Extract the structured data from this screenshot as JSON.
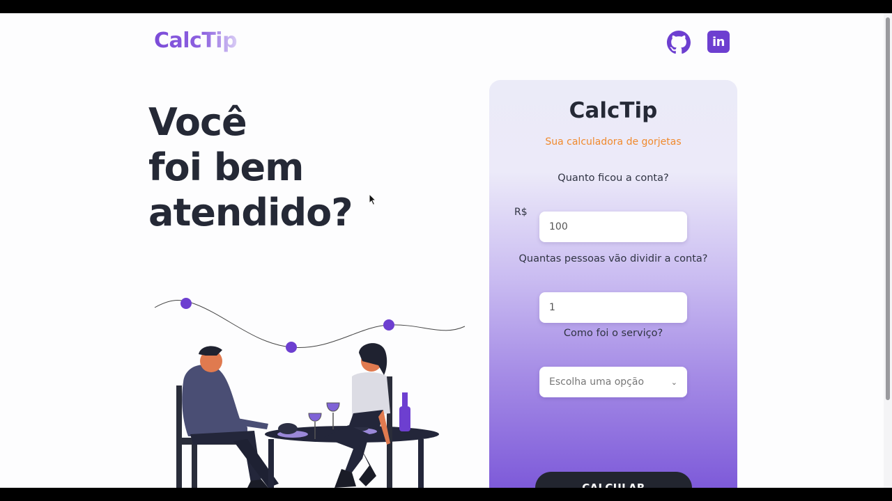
{
  "header": {
    "logo": "CalcTip",
    "icons": [
      "github-icon",
      "linkedin-icon"
    ],
    "linkedin_glyph": "in"
  },
  "hero": {
    "lines": [
      "Você",
      "foi bem",
      "atendido?"
    ]
  },
  "card": {
    "title": "CalcTip",
    "subtitle": "Sua calculadora de gorjetas",
    "bill_label": "Quanto ficou a conta?",
    "currency": "R$",
    "bill_value": "100",
    "people_label": "Quantas pessoas vão dividir a conta?",
    "people_value": "1",
    "service_label": "Como foi o serviço?",
    "service_selected": "Escolha uma opção",
    "button": "CALCULAR"
  },
  "colors": {
    "brand_purple": "#7b4bd8",
    "accent_orange": "#f08a2e",
    "dark": "#252936"
  }
}
